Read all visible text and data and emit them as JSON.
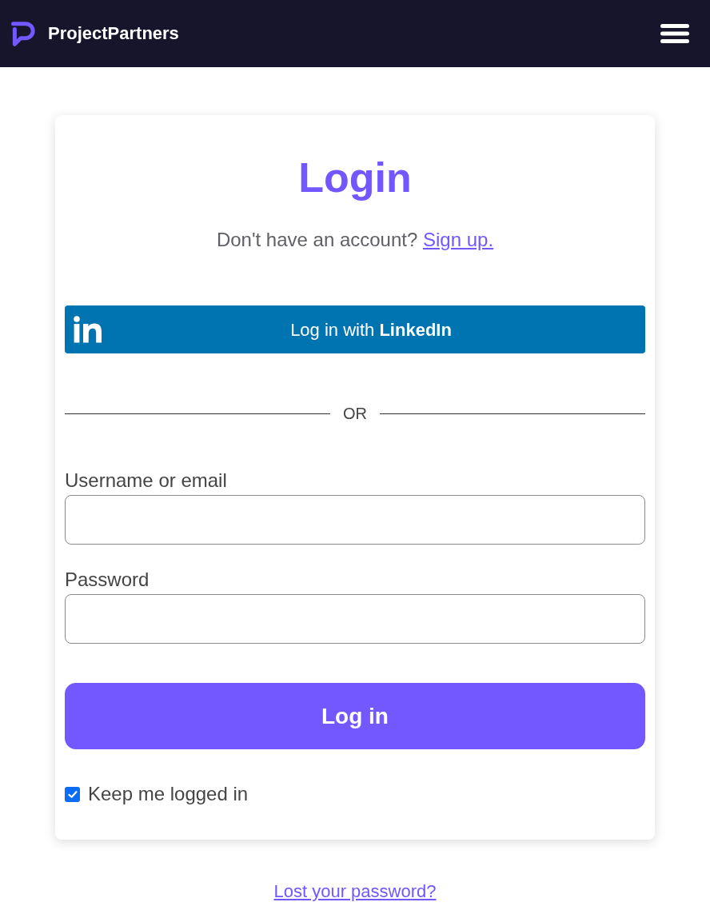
{
  "header": {
    "brand": "ProjectPartners"
  },
  "card": {
    "title": "Login",
    "signup_prompt": "Don't have an account?",
    "signup_link": "Sign up.",
    "linkedin_button": "Log in with **LinkedIn**",
    "divider": "OR",
    "fields": [
      {
        "label": "Username or email"
      },
      {
        "label": "Password"
      }
    ],
    "submit": "Log in",
    "remember": {
      "label": "Keep me logged in",
      "checked": true
    }
  },
  "lost_password": "Lost your password?"
}
